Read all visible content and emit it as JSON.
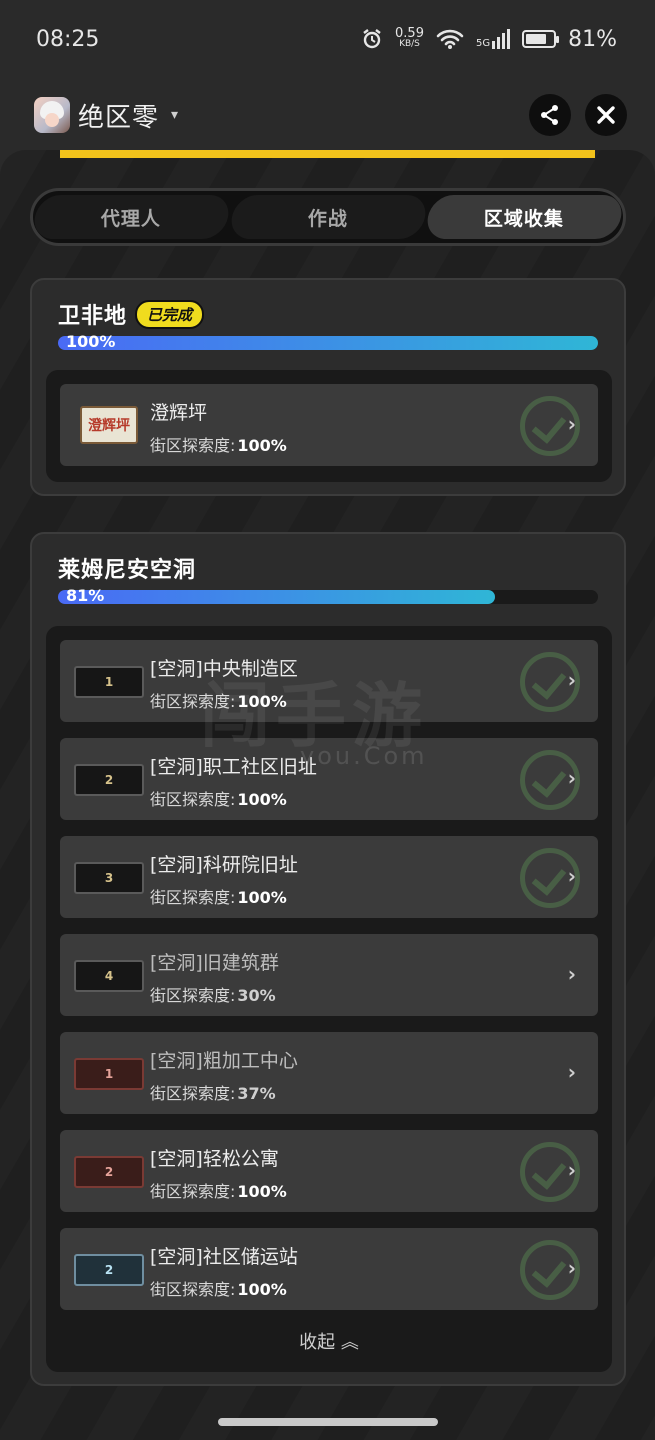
{
  "status_bar": {
    "time": "08:25",
    "net_speed": "0.59",
    "net_unit": "KB/S",
    "signal_label": "5G",
    "battery": "81%",
    "battery_level": 0.81
  },
  "header": {
    "app_title": "绝区零",
    "caret": "▾"
  },
  "tabs": [
    {
      "label": "代理人",
      "active": false
    },
    {
      "label": "作战",
      "active": false
    },
    {
      "label": "区域收集",
      "active": true
    }
  ],
  "regions": [
    {
      "title": "卫非地",
      "badge": "已完成",
      "progress_label": "100%",
      "progress": 1.0,
      "items": [
        {
          "name": "澄辉坪",
          "progress_label": "街区探索度:",
          "progress_value": "100%",
          "thumb": "澄辉坪",
          "thumb_style": "sign",
          "complete": true
        }
      ]
    },
    {
      "title": "莱姆尼安空洞",
      "progress_label": "81%",
      "progress": 0.81,
      "items": [
        {
          "name": "[空洞]中央制造区",
          "progress_label": "街区探索度:",
          "progress_value": "100%",
          "thumb": "1",
          "thumb_style": "gold",
          "complete": true
        },
        {
          "name": "[空洞]职工社区旧址",
          "progress_label": "街区探索度:",
          "progress_value": "100%",
          "thumb": "2",
          "thumb_style": "gold",
          "complete": true
        },
        {
          "name": "[空洞]科研院旧址",
          "progress_label": "街区探索度:",
          "progress_value": "100%",
          "thumb": "3",
          "thumb_style": "gold",
          "complete": true
        },
        {
          "name": "[空洞]旧建筑群",
          "progress_label": "街区探索度:",
          "progress_value": "30%",
          "thumb": "4",
          "thumb_style": "gold",
          "complete": false
        },
        {
          "name": "[空洞]粗加工中心",
          "progress_label": "街区探索度:",
          "progress_value": "37%",
          "thumb": "1",
          "thumb_style": "red",
          "complete": false
        },
        {
          "name": "[空洞]轻松公寓",
          "progress_label": "街区探索度:",
          "progress_value": "100%",
          "thumb": "2",
          "thumb_style": "red",
          "complete": true
        },
        {
          "name": "[空洞]社区储运站",
          "progress_label": "街区探索度:",
          "progress_value": "100%",
          "thumb": "2",
          "thumb_style": "blue",
          "complete": true
        }
      ],
      "collapse_label": "收起 ︽"
    }
  ],
  "watermark": {
    "main": "闯手游",
    "sub": "you.Com"
  },
  "colors": {
    "accent_yellow": "#f2c21b",
    "progress_start": "#4a6af5",
    "progress_end": "#2fb6d6",
    "badge": "#f0dc1e"
  }
}
